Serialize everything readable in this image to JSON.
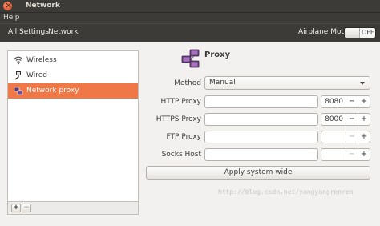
{
  "window": {
    "title": "Network"
  },
  "menubar": {
    "help": "Help"
  },
  "toolbar": {
    "breadcrumb_all": "All Settings",
    "breadcrumb_current": "Network",
    "airplane_label": "Airplane Mode",
    "airplane_state": "OFF"
  },
  "sidebar": {
    "items": [
      {
        "label": "Wireless",
        "icon": "wifi-icon",
        "selected": false
      },
      {
        "label": "Wired",
        "icon": "wired-icon",
        "selected": false
      },
      {
        "label": "Network proxy",
        "icon": "proxy-icon",
        "selected": true
      }
    ],
    "add_label": "+",
    "remove_label": "−"
  },
  "proxy": {
    "title": "Proxy",
    "method_label": "Method",
    "method_value": "Manual",
    "http_label": "HTTP Proxy",
    "http_host": "",
    "http_port": "8080",
    "https_label": "HTTPS Proxy",
    "https_host": "",
    "https_port": "8000",
    "ftp_label": "FTP Proxy",
    "ftp_host": "",
    "ftp_port": "",
    "socks_label": "Socks Host",
    "socks_host": "",
    "socks_port": "",
    "apply_label": "Apply system wide",
    "minus": "−",
    "plus": "+"
  },
  "watermark": "http://blog.csdn.net/yangyangrenren",
  "colors": {
    "accent": "#f07746",
    "titlebar": "#3c3b37"
  }
}
